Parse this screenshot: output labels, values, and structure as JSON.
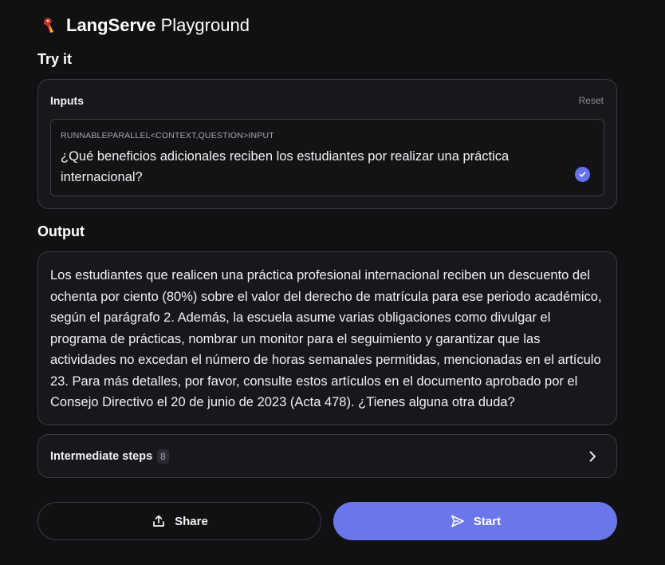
{
  "header": {
    "logo_icon": "parrot-icon",
    "title_bold": "LangServe",
    "title_light": "Playground"
  },
  "try_it": {
    "title": "Try it",
    "inputs_label": "Inputs",
    "reset_label": "Reset",
    "field": {
      "label": "RUNNABLEPARALLEL<CONTEXT,QUESTION>INPUT",
      "value": "¿Qué beneficios adicionales reciben los estudiantes por realizar una práctica internacional?",
      "status_icon": "check-circle-icon"
    }
  },
  "output": {
    "title": "Output",
    "text": "Los estudiantes que realicen una práctica profesional internacional reciben un descuento del ochenta por ciento (80%) sobre el valor del derecho de matrícula para ese periodo académico, según el parágrafo 2. Además, la escuela asume varias obligaciones como divulgar el programa de prácticas, nombrar un monitor para el seguimiento y garantizar que las actividades no excedan el número de horas semanales permitidas, mencionadas en el artículo 23. Para más detalles, por favor, consulte estos artículos en el documento aprobado por el Consejo Directivo el 20 de junio de 2023 (Acta 478). ¿Tienes alguna otra duda?"
  },
  "intermediate_steps": {
    "label": "Intermediate steps",
    "count": "8",
    "icon": "chevron-right-icon"
  },
  "actions": {
    "share_label": "Share",
    "share_icon": "share-icon",
    "start_label": "Start",
    "start_icon": "send-icon"
  },
  "colors": {
    "background": "#111114",
    "card": "#18181c",
    "border": "#3a3a42",
    "accent": "#6b76ea"
  }
}
